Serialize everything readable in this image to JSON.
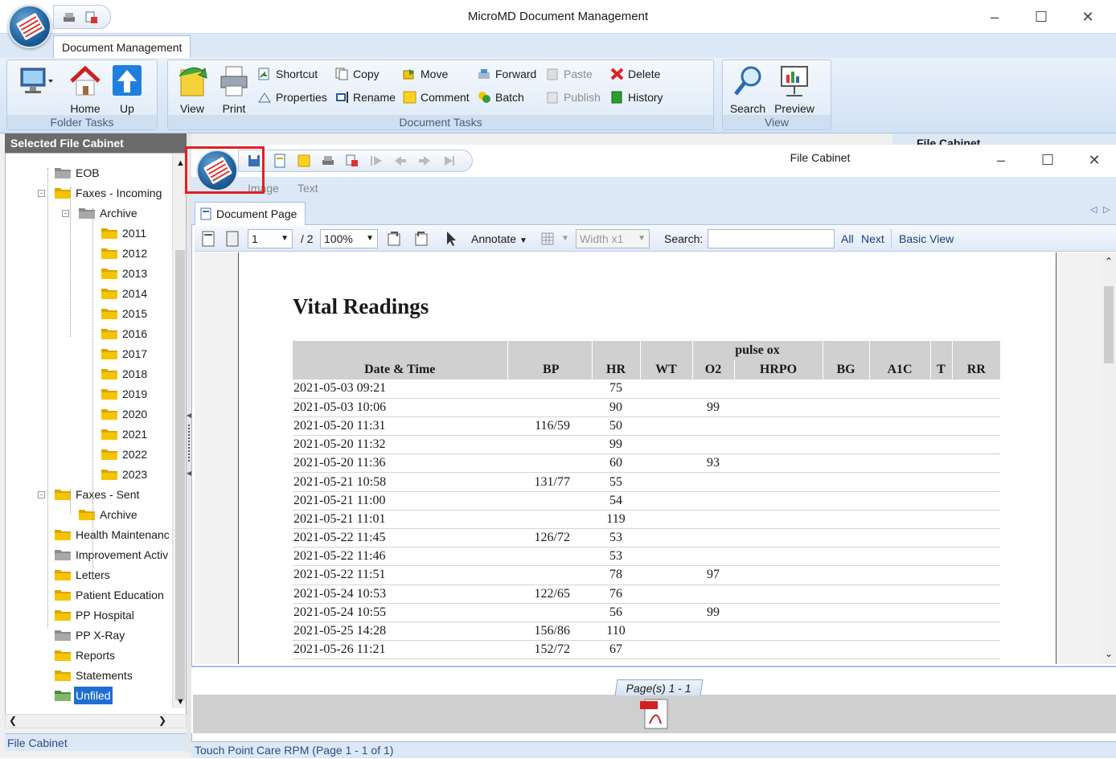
{
  "window": {
    "title": "MicroMD Document Management"
  },
  "ribbon": {
    "tab": "Document Management",
    "folder_tasks": {
      "label": "Folder Tasks",
      "home": "Home",
      "up": "Up"
    },
    "document_tasks": {
      "label": "Document Tasks",
      "view": "View",
      "print": "Print",
      "shortcut": "Shortcut",
      "properties": "Properties",
      "copy": "Copy",
      "rename": "Rename",
      "move": "Move",
      "comment": "Comment",
      "forward": "Forward",
      "batch": "Batch",
      "paste": "Paste",
      "publish": "Publish",
      "delete": "Delete",
      "history": "History"
    },
    "view_group": {
      "label": "View",
      "search": "Search",
      "preview": "Preview"
    }
  },
  "left_panel": {
    "header": "Selected File Cabinet",
    "footer": "File Cabinet",
    "tree": [
      {
        "label": "EOB"
      },
      {
        "label": "Faxes - Incoming"
      },
      {
        "label": "Archive"
      },
      {
        "label": "2011"
      },
      {
        "label": "2012"
      },
      {
        "label": "2013"
      },
      {
        "label": "2014"
      },
      {
        "label": "2015"
      },
      {
        "label": "2016"
      },
      {
        "label": "2017"
      },
      {
        "label": "2018"
      },
      {
        "label": "2019"
      },
      {
        "label": "2020"
      },
      {
        "label": "2021"
      },
      {
        "label": "2022"
      },
      {
        "label": "2023"
      },
      {
        "label": "Faxes - Sent"
      },
      {
        "label": "Archive"
      },
      {
        "label": "Health Maintenanc"
      },
      {
        "label": "Improvement Activ"
      },
      {
        "label": "Letters"
      },
      {
        "label": "Patient Education"
      },
      {
        "label": "PP Hospital"
      },
      {
        "label": "PP X-Ray"
      },
      {
        "label": "Reports"
      },
      {
        "label": "Statements"
      },
      {
        "label": "Unfiled"
      }
    ]
  },
  "behind_window_title": "File Cabinet",
  "child": {
    "title": "File Cabinet",
    "tabs": {
      "image": "Image",
      "text": "Text"
    },
    "doc_tab": "Document Page",
    "toolbar": {
      "page_value": "1",
      "page_total": "/ 2",
      "zoom": "100%",
      "annotate": "Annotate",
      "width": "Width x1",
      "search_label": "Search:",
      "search_value": "",
      "all": "All",
      "next": "Next",
      "basic_view": "Basic View"
    },
    "pages_tab": "Page(s) 1 - 1",
    "status": "Touch Point Care RPM   (Page 1 - 1 of 1)"
  },
  "document": {
    "title": "Vital Readings",
    "group_header": "pulse ox",
    "columns": [
      "Date & Time",
      "BP",
      "HR",
      "WT",
      "O2",
      "HRPO",
      "BG",
      "A1C",
      "T",
      "RR"
    ],
    "rows": [
      [
        "2021-05-03 09:21",
        "",
        "75",
        "",
        "",
        "",
        "",
        "",
        "",
        ""
      ],
      [
        "2021-05-03 10:06",
        "",
        "90",
        "",
        "99",
        "",
        "",
        "",
        "",
        ""
      ],
      [
        "2021-05-20 11:31",
        "116/59",
        "50",
        "",
        "",
        "",
        "",
        "",
        "",
        ""
      ],
      [
        "2021-05-20 11:32",
        "",
        "99",
        "",
        "",
        "",
        "",
        "",
        "",
        ""
      ],
      [
        "2021-05-20 11:36",
        "",
        "60",
        "",
        "93",
        "",
        "",
        "",
        "",
        ""
      ],
      [
        "2021-05-21 10:58",
        "131/77",
        "55",
        "",
        "",
        "",
        "",
        "",
        "",
        ""
      ],
      [
        "2021-05-21 11:00",
        "",
        "54",
        "",
        "",
        "",
        "",
        "",
        "",
        ""
      ],
      [
        "2021-05-21 11:01",
        "",
        "119",
        "",
        "",
        "",
        "",
        "",
        "",
        ""
      ],
      [
        "2021-05-22 11:45",
        "126/72",
        "53",
        "",
        "",
        "",
        "",
        "",
        "",
        ""
      ],
      [
        "2021-05-22 11:46",
        "",
        "53",
        "",
        "",
        "",
        "",
        "",
        "",
        ""
      ],
      [
        "2021-05-22 11:51",
        "",
        "78",
        "",
        "97",
        "",
        "",
        "",
        "",
        ""
      ],
      [
        "2021-05-24 10:53",
        "122/65",
        "76",
        "",
        "",
        "",
        "",
        "",
        "",
        ""
      ],
      [
        "2021-05-24 10:55",
        "",
        "56",
        "",
        "99",
        "",
        "",
        "",
        "",
        ""
      ],
      [
        "2021-05-25 14:28",
        "156/86",
        "110",
        "",
        "",
        "",
        "",
        "",
        "",
        ""
      ],
      [
        "2021-05-26 11:21",
        "152/72",
        "67",
        "",
        "",
        "",
        "",
        "",
        "",
        ""
      ]
    ]
  },
  "colors": {
    "ribbon_blue": "#dce8f6",
    "highlight": "#e02020",
    "folder": "#f5c400"
  }
}
